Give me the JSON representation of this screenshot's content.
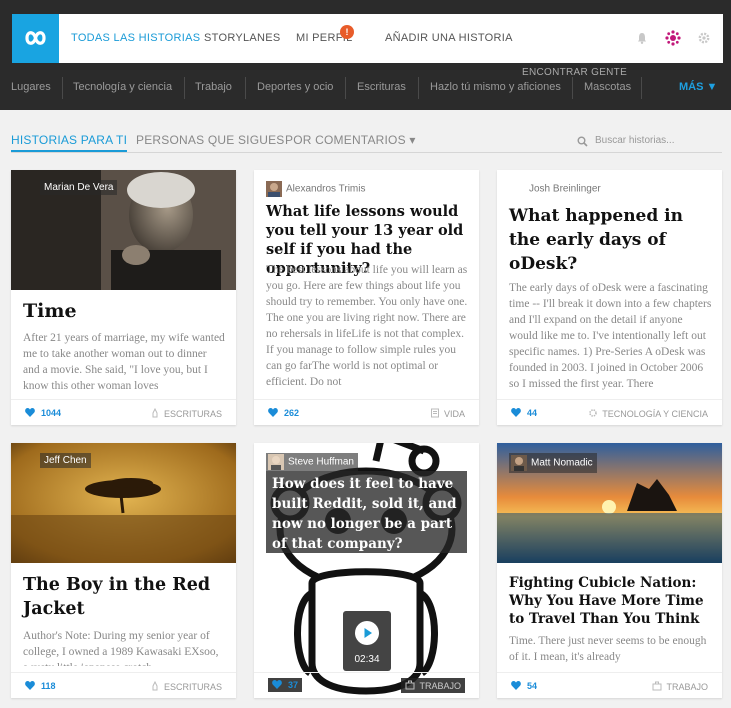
{
  "navbar": {
    "links": [
      "TODAS LAS HISTORIAS",
      "STORYLANES",
      "MI PERFIL",
      "AÑADIR UNA HISTORIA"
    ],
    "notif_count": "!"
  },
  "encontrar": "ENCONTRAR GENTE",
  "categories": [
    "Lugares",
    "Tecnología y ciencia",
    "Trabajo",
    "Deportes y ocio",
    "Escrituras",
    "Hazlo tú mismo y aficiones",
    "Mascotas"
  ],
  "mas_label": "MÁS ▼",
  "tabs": [
    "HISTORIAS PARA TI",
    "PERSONAS QUE SIGUES",
    "POR COMENTARIOS ▾"
  ],
  "search": {
    "placeholder": "Buscar historias..."
  },
  "cards": [
    {
      "author": "Marian De Vera",
      "title": "Time",
      "body": "After 21 years of marriage, my wife wanted me to take another woman out to dinner and a movie. She said, \"I love you, but I know this other woman loves",
      "likes": "1044",
      "category": "ESCRITURAS"
    },
    {
      "author": "Alexandros Trimis",
      "title": "What life lessons would you tell your 13 year old self if you had the opportunity?",
      "body": "The best lessons about life you will learn as you go. Here are few things about life you should try to remember. You only have one. The one you are living right now. There are no rehersals in lifeLife is not that complex. If you manage to follow simple rules you can go farThe world is not optimal or efficient. Do not",
      "likes": "262",
      "category": "VIDA"
    },
    {
      "author": "Josh Breinlinger",
      "title": "What happened in the early days of oDesk?",
      "body": "The early days of oDesk were a fascinating time -- I'll break it down into a few chapters and I'll expand on the detail if anyone would like me to. I've intentionally left out specific names. 1) Pre-Series A oDesk was founded in 2003. I joined in October 2006 so I missed the first year. There",
      "likes": "44",
      "category": "TECNOLOGÍA Y CIENCIA"
    },
    {
      "author": "Jeff Chen",
      "title": "The Boy in the Red Jacket",
      "body": "Author's Note: During my senior year of college, I owned a 1989 Kawasaki EXsoo, a rusty little japanese crotch",
      "likes": "118",
      "category": "ESCRITURAS"
    },
    {
      "author": "Steve Huffman",
      "title": "How does it feel to have built Reddit, sold it, and now no longer be a part of that company?",
      "video_time": "02:34",
      "likes": "37",
      "category": "TRABAJO"
    },
    {
      "author": "Matt Nomadic",
      "title": "Fighting Cubicle Nation: Why You Have More Time to Travel Than You Think",
      "body": "Time. There just never seems to be enough of it. I mean, it's already",
      "likes": "54",
      "category": "TRABAJO"
    }
  ],
  "colors": {
    "accent": "#1a9bd7",
    "frame": "#2b2b2b",
    "badge": "#e85c2a"
  }
}
